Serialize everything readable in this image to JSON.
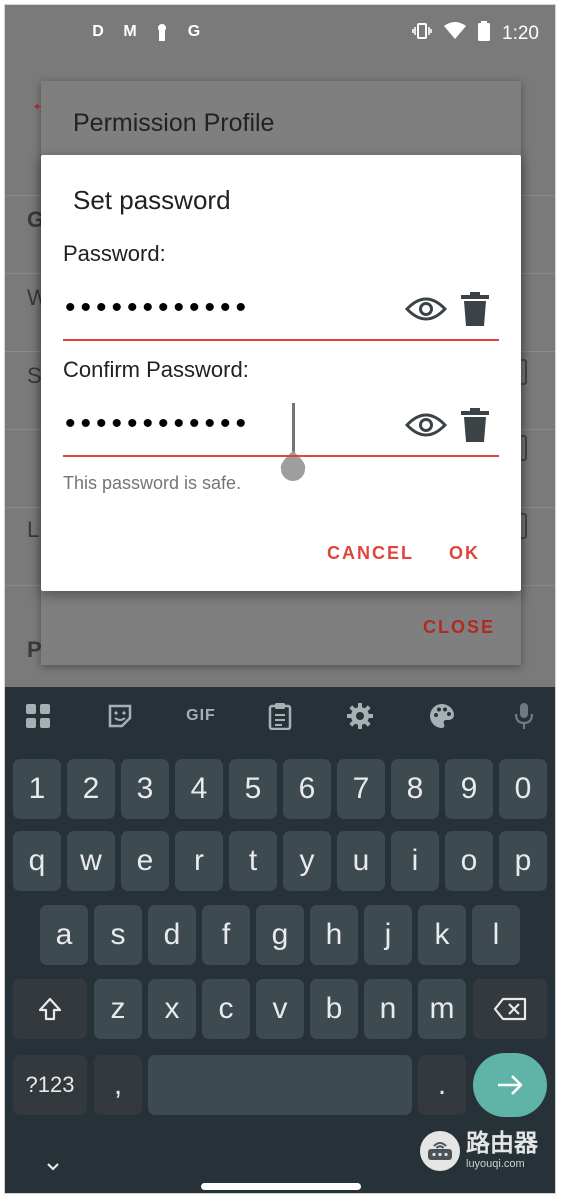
{
  "status_bar": {
    "time": "1:20",
    "left_icons": [
      "d-app-icon",
      "gmail-icon",
      "keyhole-icon",
      "google-icon"
    ],
    "left_glyphs": [
      "D",
      "M",
      "",
      "G"
    ],
    "right_icons": [
      "vibrate-icon",
      "wifi-icon",
      "battery-icon"
    ]
  },
  "background": {
    "dialog_title": "Permission Profile",
    "close_label": "CLOSE",
    "row_letters": [
      "G",
      "W",
      "S",
      "L",
      "P"
    ]
  },
  "dialog": {
    "title": "Set password",
    "password_label": "Password:",
    "password_value": "••••••••••••",
    "confirm_label": "Confirm Password:",
    "confirm_value": "••••••••••••",
    "hint": "This password is safe.",
    "cancel_label": "CANCEL",
    "ok_label": "OK"
  },
  "keyboard": {
    "toolbar": [
      "apps-grid-icon",
      "sticker-icon",
      "gif-icon",
      "clipboard-icon",
      "settings-icon",
      "palette-icon",
      "microphone-icon"
    ],
    "gif_label": "GIF",
    "row1": [
      "1",
      "2",
      "3",
      "4",
      "5",
      "6",
      "7",
      "8",
      "9",
      "0"
    ],
    "row2": [
      "q",
      "w",
      "e",
      "r",
      "t",
      "y",
      "u",
      "i",
      "o",
      "p"
    ],
    "row3": [
      "a",
      "s",
      "d",
      "f",
      "g",
      "h",
      "j",
      "k",
      "l"
    ],
    "row4": [
      "z",
      "x",
      "c",
      "v",
      "b",
      "n",
      "m"
    ],
    "symbols_label": "?123",
    "comma_label": ",",
    "period_label": ".",
    "enter_icon": "arrow-right-icon",
    "shift_icon": "shift-icon",
    "backspace_icon": "backspace-icon"
  },
  "watermark": {
    "cn_text": "路由器",
    "url": "luyouqi.com"
  },
  "colors": {
    "accent": "#e0443a",
    "keyboard_bg": "#263238",
    "key_bg": "#3d4a50",
    "enter_bg": "#5fb4a7"
  }
}
